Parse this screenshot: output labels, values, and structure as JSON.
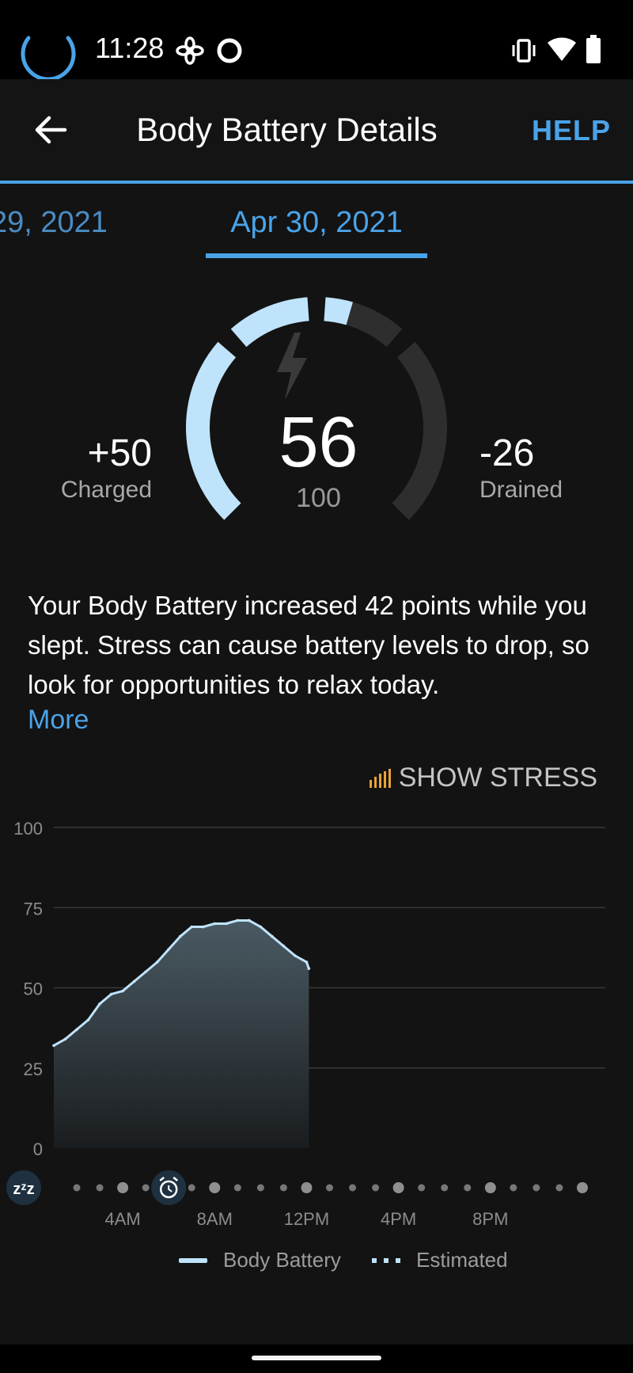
{
  "status_bar": {
    "time": "11:28",
    "icons": [
      "loading-ring-icon",
      "fan-icon",
      "circle-icon",
      "vibrate-icon",
      "wifi-icon",
      "battery-icon"
    ]
  },
  "app_bar": {
    "back_icon": "arrow-left-icon",
    "title": "Body Battery Details",
    "help_label": "HELP"
  },
  "date_tabs": {
    "previous": "29, 2021",
    "current": "Apr 30, 2021"
  },
  "gauge": {
    "value": "56",
    "max": "100",
    "fill_fraction": 0.56,
    "charged_value": "+50",
    "charged_label": "Charged",
    "drained_value": "-26",
    "drained_label": "Drained",
    "bolt_icon": "lightning-bolt-icon"
  },
  "insight": {
    "text": "Your Body Battery increased 42 points while you slept. Stress can cause battery levels to drop, so look for opportunities to relax today.",
    "more_label": "More"
  },
  "stress_toggle": {
    "label": "SHOW STRESS",
    "icon": "bars-icon"
  },
  "chart_data": {
    "type": "area",
    "ylim": [
      0,
      100
    ],
    "y_ticks": [
      "0",
      "25",
      "50",
      "75",
      "100"
    ],
    "x_tick_labels": [
      "4AM",
      "8AM",
      "12PM",
      "4PM",
      "8PM"
    ],
    "xlim_hours": [
      1,
      25
    ],
    "series": [
      {
        "name": "Body Battery",
        "x_hours": [
          1.0,
          1.5,
          2.0,
          2.5,
          3.0,
          3.5,
          4.0,
          4.5,
          5.0,
          5.5,
          6.0,
          6.5,
          7.0,
          7.5,
          8.0,
          8.5,
          9.0,
          9.5,
          10.0,
          10.5,
          11.0,
          11.5,
          12.0,
          12.1
        ],
        "values": [
          32,
          34,
          37,
          40,
          45,
          48,
          49,
          52,
          55,
          58,
          62,
          66,
          69,
          69,
          70,
          70,
          71,
          71,
          69,
          66,
          63,
          60,
          58,
          56
        ]
      }
    ],
    "legend": [
      "Body Battery",
      "Estimated"
    ],
    "legend_position": "bottom",
    "grid": true,
    "sleep_icon": "zzz-sleep-icon",
    "wake_icon": "alarm-clock-icon",
    "wake_hour": 6
  },
  "colors": {
    "accent": "#4aa3e8",
    "gauge_fill": "#bfe3fb",
    "gauge_track": "#2e2e2e",
    "chart_line": "#bfe3fb",
    "chart_fill_top": "#4a5a63",
    "stress_icon": "#e8a23a"
  }
}
